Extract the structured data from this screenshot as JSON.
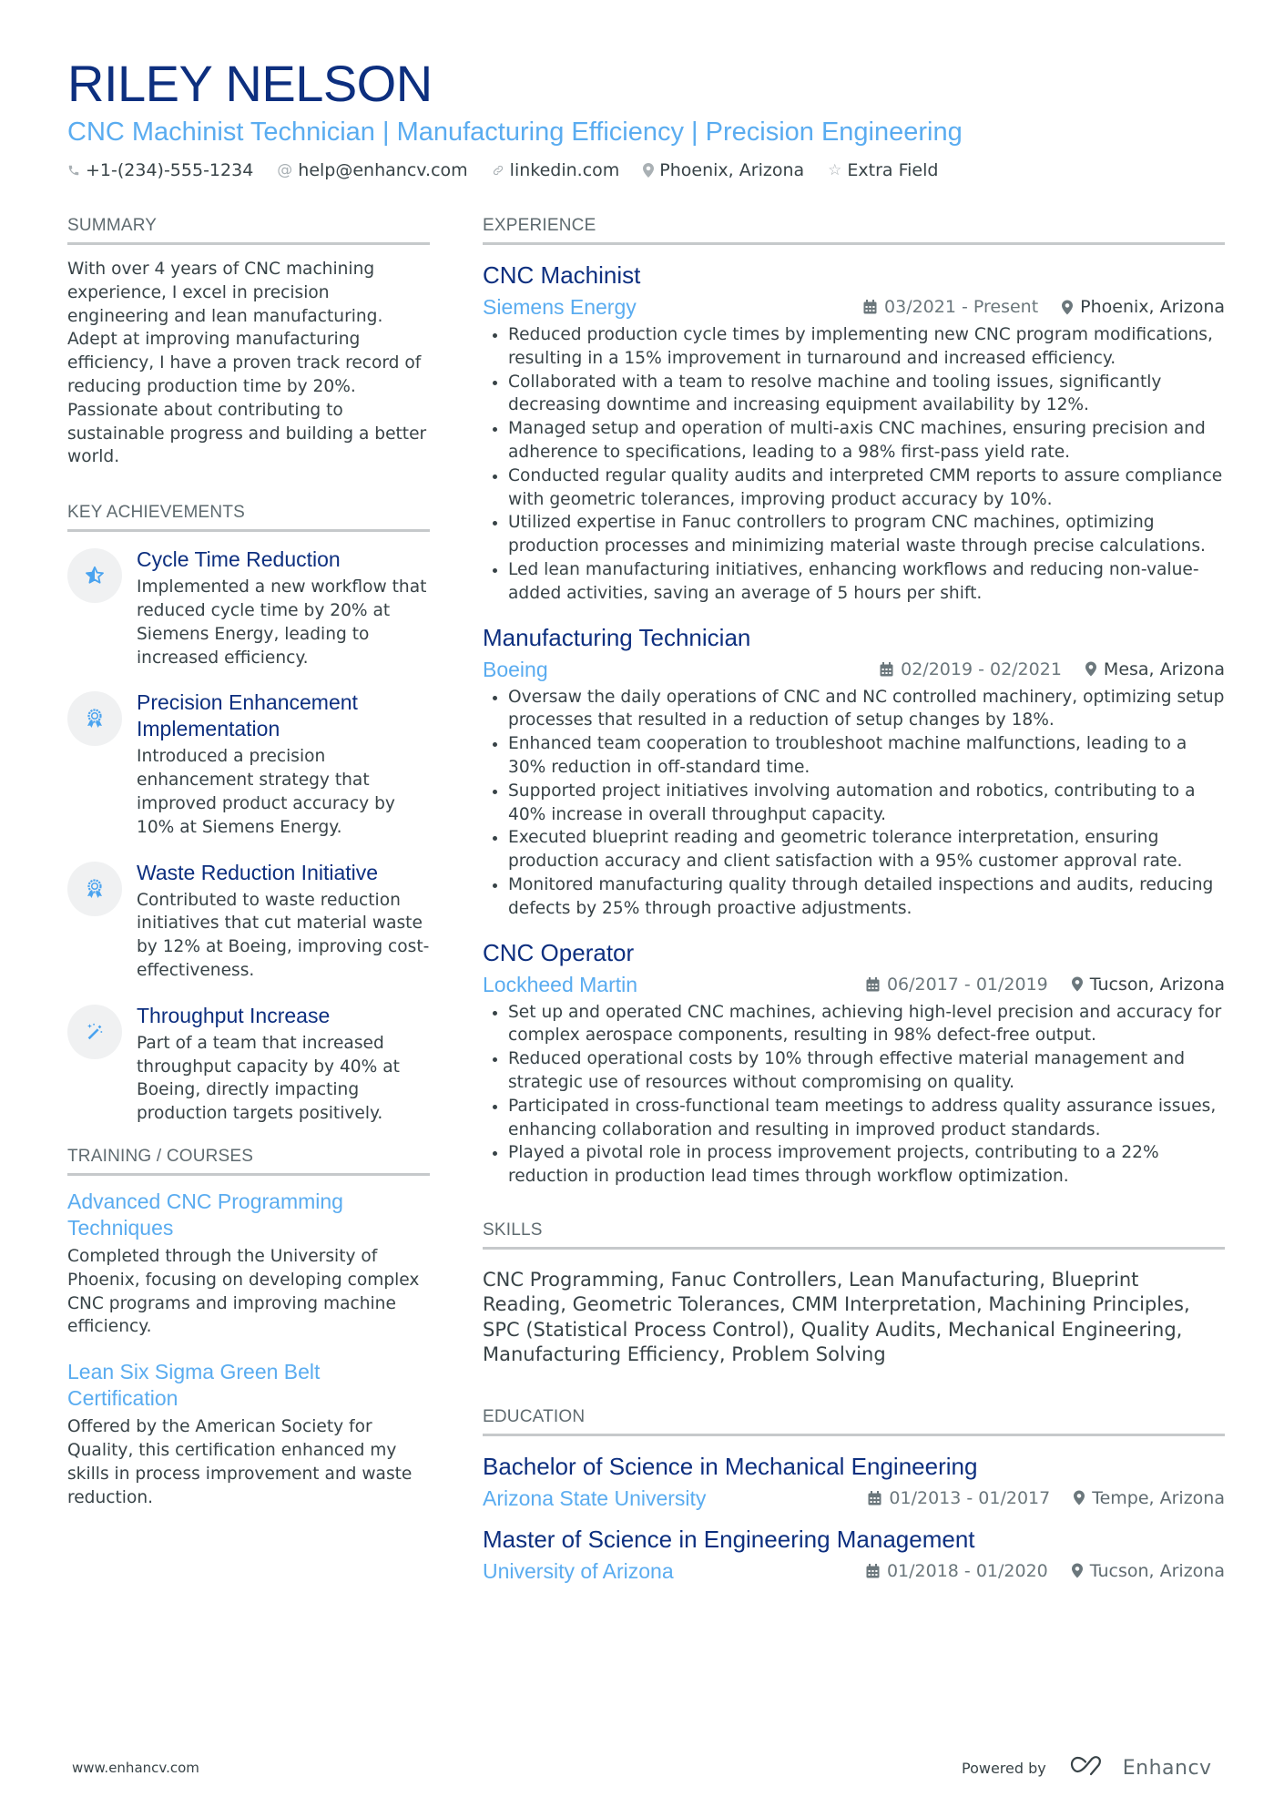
{
  "header": {
    "name": "RILEY NELSON",
    "subtitle": "CNC Machinist Technician | Manufacturing Efficiency | Precision Engineering",
    "contacts": [
      {
        "icon": "phone-icon",
        "text": "+1-(234)-555-1234"
      },
      {
        "icon": "at-icon",
        "text": "help@enhancv.com"
      },
      {
        "icon": "link-icon",
        "text": "linkedin.com"
      },
      {
        "icon": "location-pin-icon",
        "text": "Phoenix, Arizona"
      },
      {
        "icon": "star-outline-icon",
        "text": "Extra Field"
      }
    ]
  },
  "summary": {
    "title": "SUMMARY",
    "text": "With over 4 years of CNC machining experience, I excel in precision engineering and lean manufacturing. Adept at improving manufacturing efficiency, I have a proven track record of reducing production time by 20%. Passionate about contributing to sustainable progress and building a better world."
  },
  "achievements": {
    "title": "KEY ACHIEVEMENTS",
    "items": [
      {
        "icon": "star-half-icon",
        "title": "Cycle Time Reduction",
        "text": "Implemented a new workflow that reduced cycle time by 20% at Siemens Energy, leading to increased efficiency."
      },
      {
        "icon": "award-ribbon-icon",
        "title": "Precision Enhancement Implementation",
        "text": "Introduced a precision enhancement strategy that improved product accuracy by 10% at Siemens Energy."
      },
      {
        "icon": "award-ribbon-icon",
        "title": "Waste Reduction Initiative",
        "text": "Contributed to waste reduction initiatives that cut material waste by 12% at Boeing, improving cost-effectiveness."
      },
      {
        "icon": "magic-wand-icon",
        "title": "Throughput Increase",
        "text": "Part of a team that increased throughput capacity by 40% at Boeing, directly impacting production targets positively."
      }
    ]
  },
  "training": {
    "title": "TRAINING / COURSES",
    "items": [
      {
        "title": "Advanced CNC Programming Techniques",
        "text": "Completed through the University of Phoenix, focusing on developing complex CNC programs and improving machine efficiency."
      },
      {
        "title": "Lean Six Sigma Green Belt Certification",
        "text": "Offered by the American Society for Quality, this certification enhanced my skills in process improvement and waste reduction."
      }
    ]
  },
  "experience": {
    "title": "EXPERIENCE",
    "jobs": [
      {
        "title": "CNC Machinist",
        "company": "Siemens Energy",
        "dates": "03/2021 - Present",
        "location": "Phoenix, Arizona",
        "bullets": [
          "Reduced production cycle times by implementing new CNC program modifications, resulting in a 15% improvement in turnaround and increased efficiency.",
          "Collaborated with a team to resolve machine and tooling issues, significantly decreasing downtime and increasing equipment availability by 12%.",
          "Managed setup and operation of multi-axis CNC machines, ensuring precision and adherence to specifications, leading to a 98% first-pass yield rate.",
          "Conducted regular quality audits and interpreted CMM reports to assure compliance with geometric tolerances, improving product accuracy by 10%.",
          "Utilized expertise in Fanuc controllers to program CNC machines, optimizing production processes and minimizing material waste through precise calculations.",
          "Led lean manufacturing initiatives, enhancing workflows and reducing non-value-added activities, saving an average of 5 hours per shift."
        ]
      },
      {
        "title": "Manufacturing Technician",
        "company": "Boeing",
        "dates": "02/2019 - 02/2021",
        "location": "Mesa, Arizona",
        "bullets": [
          "Oversaw the daily operations of CNC and NC controlled machinery, optimizing setup processes that resulted in a reduction of setup changes by 18%.",
          "Enhanced team cooperation to troubleshoot machine malfunctions, leading to a 30% reduction in off-standard time.",
          "Supported project initiatives involving automation and robotics, contributing to a 40% increase in overall throughput capacity.",
          "Executed blueprint reading and geometric tolerance interpretation, ensuring production accuracy and client satisfaction with a 95% customer approval rate.",
          "Monitored manufacturing quality through detailed inspections and audits, reducing defects by 25% through proactive adjustments."
        ]
      },
      {
        "title": "CNC Operator",
        "company": "Lockheed Martin",
        "dates": "06/2017 - 01/2019",
        "location": "Tucson, Arizona",
        "bullets": [
          "Set up and operated CNC machines, achieving high-level precision and accuracy for complex aerospace components, resulting in 98% defect-free output.",
          "Reduced operational costs by 10% through effective material management and strategic use of resources without compromising on quality.",
          "Participated in cross-functional team meetings to address quality assurance issues, enhancing collaboration and resulting in improved product standards.",
          "Played a pivotal role in process improvement projects, contributing to a 22% reduction in production lead times through workflow optimization."
        ]
      }
    ]
  },
  "skills": {
    "title": "SKILLS",
    "text": "CNC Programming, Fanuc Controllers, Lean Manufacturing, Blueprint Reading, Geometric Tolerances, CMM Interpretation, Machining Principles, SPC (Statistical Process Control), Quality Audits, Mechanical Engineering, Manufacturing Efficiency, Problem Solving"
  },
  "education": {
    "title": "EDUCATION",
    "items": [
      {
        "degree": "Bachelor of Science in Mechanical Engineering",
        "school": "Arizona State University",
        "dates": "01/2013 - 01/2017",
        "location": "Tempe, Arizona"
      },
      {
        "degree": "Master of Science in Engineering Management",
        "school": "University of Arizona",
        "dates": "01/2018 - 01/2020",
        "location": "Tucson, Arizona"
      }
    ]
  },
  "footer": {
    "website": "www.enhancv.com",
    "powered_by": "Powered by",
    "brand": "Enhancv"
  },
  "colors": {
    "name": "#0d2f7f",
    "accent": "#5aacf0",
    "text": "#384347",
    "rule": "#c6c9cb"
  }
}
